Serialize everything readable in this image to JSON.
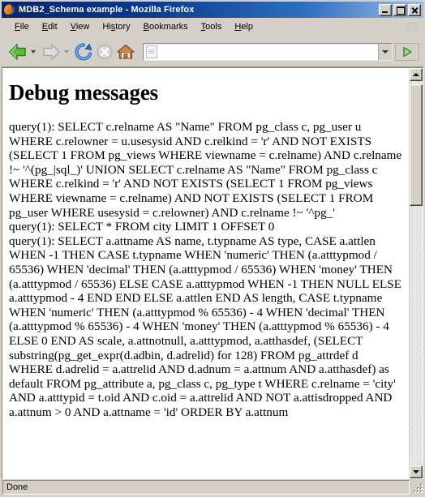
{
  "window": {
    "title": "MDB2_Schema example - Mozilla Firefox",
    "app_icon": "firefox-icon",
    "caption": {
      "minimize_label": "Minimize",
      "maximize_label": "Maximize",
      "close_label": "Close"
    }
  },
  "menubar": {
    "items": [
      {
        "label": "File",
        "accesskey": "F",
        "pre": "",
        "post": "ile"
      },
      {
        "label": "Edit",
        "accesskey": "E",
        "pre": "",
        "post": "dit"
      },
      {
        "label": "View",
        "accesskey": "V",
        "pre": "",
        "post": "iew"
      },
      {
        "label": "History",
        "accesskey": "s",
        "pre": "Hi",
        "post": "tory"
      },
      {
        "label": "Bookmarks",
        "accesskey": "B",
        "pre": "",
        "post": "ookmarks"
      },
      {
        "label": "Tools",
        "accesskey": "T",
        "pre": "",
        "post": "ools"
      },
      {
        "label": "Help",
        "accesskey": "H",
        "pre": "",
        "post": "elp"
      }
    ]
  },
  "toolbar": {
    "back_label": "Back",
    "forward_label": "Forward",
    "reload_label": "Reload",
    "stop_label": "Stop",
    "home_label": "Home",
    "go_label": "Go",
    "address": {
      "value": "",
      "placeholder": ""
    }
  },
  "page": {
    "heading": "Debug messages",
    "lines": [
      "query(1): SELECT c.relname AS \"Name\" FROM pg_class c, pg_user u WHERE c.relowner = u.usesysid AND c.relkind = 'r' AND NOT EXISTS (SELECT 1 FROM pg_views WHERE viewname = c.relname) AND c.relname !~ '^(pg_|sql_)' UNION SELECT c.relname AS \"Name\" FROM pg_class c WHERE c.relkind = 'r' AND NOT EXISTS (SELECT 1 FROM pg_views WHERE viewname = c.relname) AND NOT EXISTS (SELECT 1 FROM pg_user WHERE usesysid = c.relowner) AND c.relname !~ '^pg_'",
      "query(1): SELECT * FROM city LIMIT 1 OFFSET 0",
      "query(1): SELECT a.attname AS name, t.typname AS type, CASE a.attlen WHEN -1 THEN CASE t.typname WHEN 'numeric' THEN (a.atttypmod / 65536) WHEN 'decimal' THEN (a.atttypmod / 65536) WHEN 'money' THEN (a.atttypmod / 65536) ELSE CASE a.atttypmod WHEN -1 THEN NULL ELSE a.atttypmod - 4 END END ELSE a.attlen END AS length, CASE t.typname WHEN 'numeric' THEN (a.atttypmod % 65536) - 4 WHEN 'decimal' THEN (a.atttypmod % 65536) - 4 WHEN 'money' THEN (a.atttypmod % 65536) - 4 ELSE 0 END AS scale, a.attnotnull, a.atttypmod, a.atthasdef, (SELECT substring(pg_get_expr(d.adbin, d.adrelid) for 128) FROM pg_attrdef d WHERE d.adrelid = a.attrelid AND d.adnum = a.attnum AND a.atthasdef) as default FROM pg_attribute a, pg_class c, pg_type t WHERE c.relname = 'city' AND a.atttypid = t.oid AND c.oid = a.attrelid AND NOT a.attisdropped AND a.attnum > 0 AND a.attname = 'id' ORDER BY a.attnum"
    ]
  },
  "statusbar": {
    "status": "Done"
  },
  "colors": {
    "titlebar_start": "#0a246a",
    "titlebar_end": "#9bbce8",
    "chrome": "#d4d0c8",
    "page_bg": "#ffffff",
    "text": "#000000",
    "back_arrow": "#4aa02c",
    "forward_arrow": "#b9b9b9",
    "reload_blue": "#2a6fc2",
    "go_green": "#3aa13a",
    "home_roof": "#9a5a2a"
  }
}
